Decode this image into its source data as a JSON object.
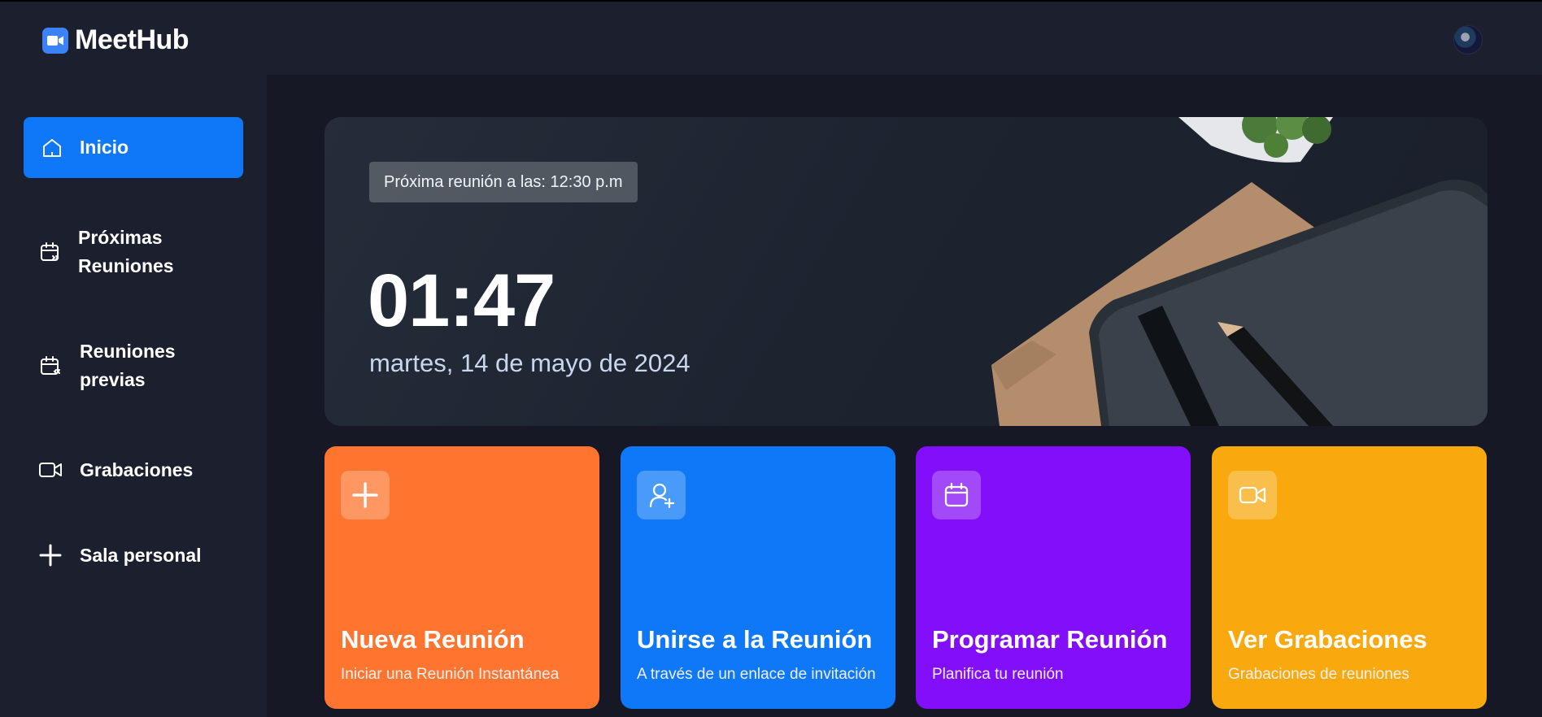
{
  "app": {
    "name": "MeetHub",
    "accent": "#0e78f9"
  },
  "header": {
    "avatar_icon": "user-avatar"
  },
  "sidebar": {
    "items": [
      {
        "label": "Inicio",
        "icon": "home-icon",
        "active": true
      },
      {
        "label_line1": "Próximas",
        "label_line2": "Reuniones",
        "icon": "calendar-upcoming-icon"
      },
      {
        "label_line1": "Reuniones",
        "label_line2": "previas",
        "icon": "calendar-previous-icon"
      },
      {
        "label": "Grabaciones",
        "icon": "video-icon"
      },
      {
        "label": "Sala personal",
        "icon": "plus-icon"
      }
    ]
  },
  "hero": {
    "next_meeting": "Próxima reunión a las: 12:30 p.m",
    "time": "01:47",
    "date": "martes, 14 de mayo de 2024"
  },
  "cards": [
    {
      "title": "Nueva Reunión",
      "subtitle": "Iniciar una Reunión Instantánea",
      "color": "#ff742e",
      "icon": "plus-icon"
    },
    {
      "title": "Unirse a la Reunión",
      "subtitle": "A través de un enlace de invitación",
      "color": "#0e78f9",
      "icon": "user-add-icon"
    },
    {
      "title": "Programar Reunión",
      "subtitle": "Planifica tu reunión",
      "color": "#830ef9",
      "icon": "calendar-icon"
    },
    {
      "title": "Ver Grabaciones",
      "subtitle": "Grabaciones de reuniones",
      "color": "#f9a90e",
      "icon": "video-icon"
    }
  ]
}
